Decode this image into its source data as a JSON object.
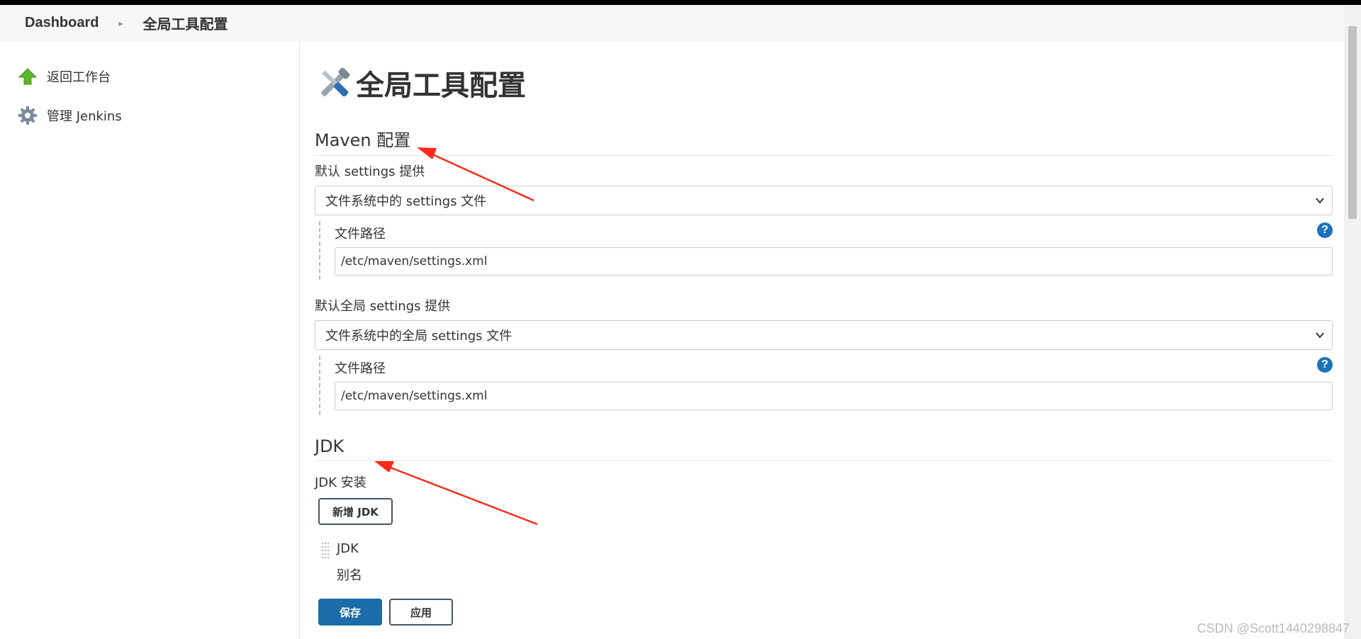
{
  "breadcrumb": {
    "home": "Dashboard",
    "current": "全局工具配置"
  },
  "sidebar": {
    "items": [
      {
        "label": "返回工作台",
        "icon": "up-arrow-icon"
      },
      {
        "label": "管理 Jenkins",
        "icon": "gear-icon"
      }
    ]
  },
  "page": {
    "title": "全局工具配置",
    "icon": "tools-icon"
  },
  "maven": {
    "section_title": "Maven 配置",
    "settings": {
      "label": "默认 settings 提供",
      "selected": "文件系统中的 settings 文件",
      "path_label": "文件路径",
      "path_value": "/etc/maven/settings.xml"
    },
    "global_settings": {
      "label": "默认全局 settings 提供",
      "selected": "文件系统中的全局 settings 文件",
      "path_label": "文件路径",
      "path_value": "/etc/maven/settings.xml"
    }
  },
  "jdk": {
    "section_title": "JDK",
    "install_label": "JDK 安装",
    "add_button": "新增 JDK",
    "item_title": "JDK",
    "alias_label": "别名"
  },
  "actions": {
    "save": "保存",
    "apply": "应用"
  },
  "help_symbol": "?",
  "watermark": "CSDN @Scott1440298847",
  "colors": {
    "primary_button": "#1b6ca8",
    "help_icon": "#1d72b8",
    "annotation_arrow": "#ff2a1a"
  }
}
